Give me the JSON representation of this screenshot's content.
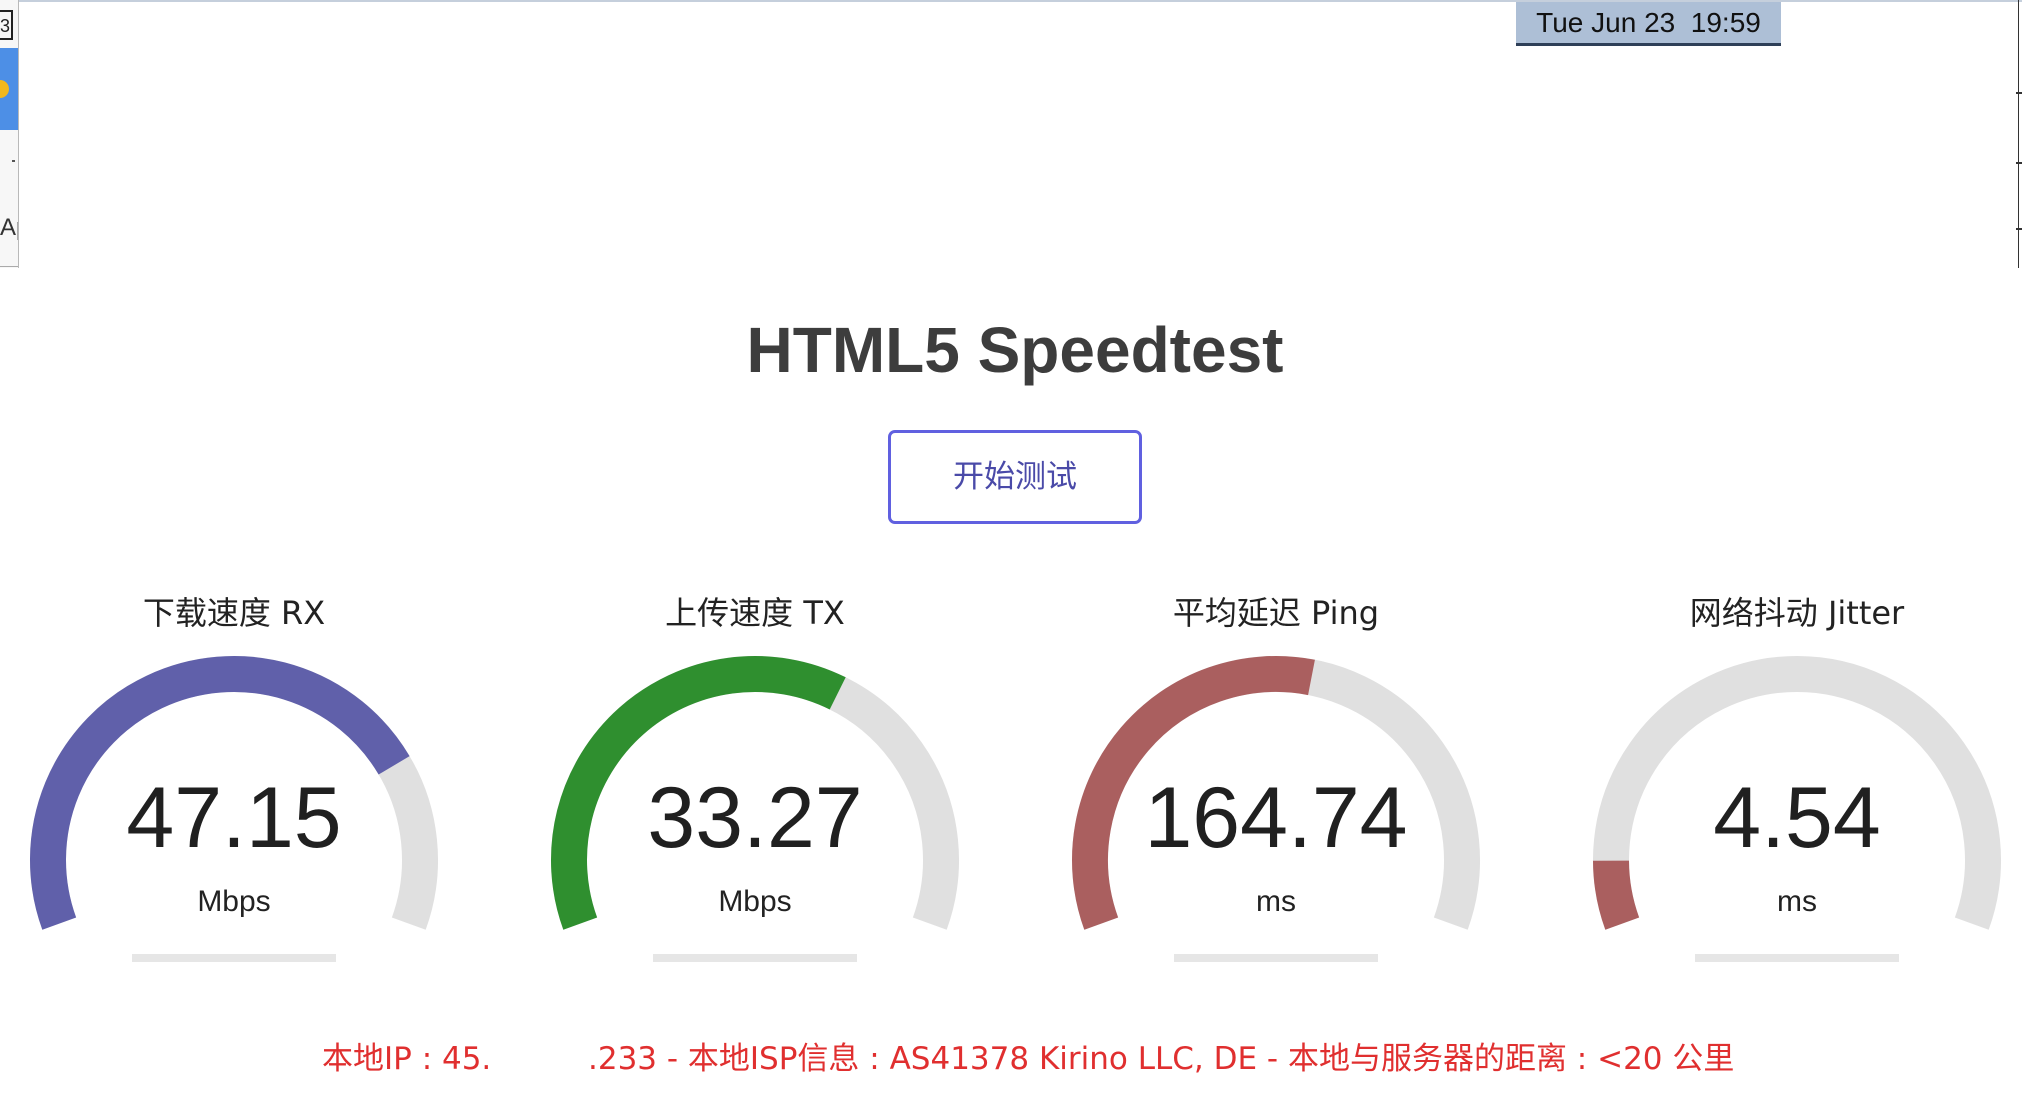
{
  "system": {
    "clock": "Tue Jun 23  19:59"
  },
  "left_window": {
    "text_fragment": "Ap",
    "box_fragment": "3"
  },
  "app": {
    "title": "HTML5 Speedtest",
    "start_button": "开始测试"
  },
  "colors": {
    "download": "#6060aa",
    "upload": "#2f8f2f",
    "ping": "#aa5f5f",
    "jitter": "#aa5f5f",
    "track": "#e0e0e0",
    "info_text": "#e02f2f",
    "button_border": "#6060e0"
  },
  "gauges": [
    {
      "label": "下载速度 RX",
      "value": "47.15",
      "unit": "Mbps",
      "level": 0.77,
      "color_key": "download"
    },
    {
      "label": "上传速度 TX",
      "value": "33.27",
      "unit": "Mbps",
      "level": 0.62,
      "color_key": "upload"
    },
    {
      "label": "平均延迟 Ping",
      "value": "164.74",
      "unit": "ms",
      "level": 0.55,
      "color_key": "ping"
    },
    {
      "label": "网络抖动 Jitter",
      "value": "4.54",
      "unit": "ms",
      "level": 0.09,
      "color_key": "jitter"
    }
  ],
  "info": {
    "ip_part1": "本地IP : 45.",
    "ip_part2": ".233 - 本地ISP信息 : AS41378 Kirino LLC, DE - 本地与服务器的距离 : <20 公里"
  }
}
